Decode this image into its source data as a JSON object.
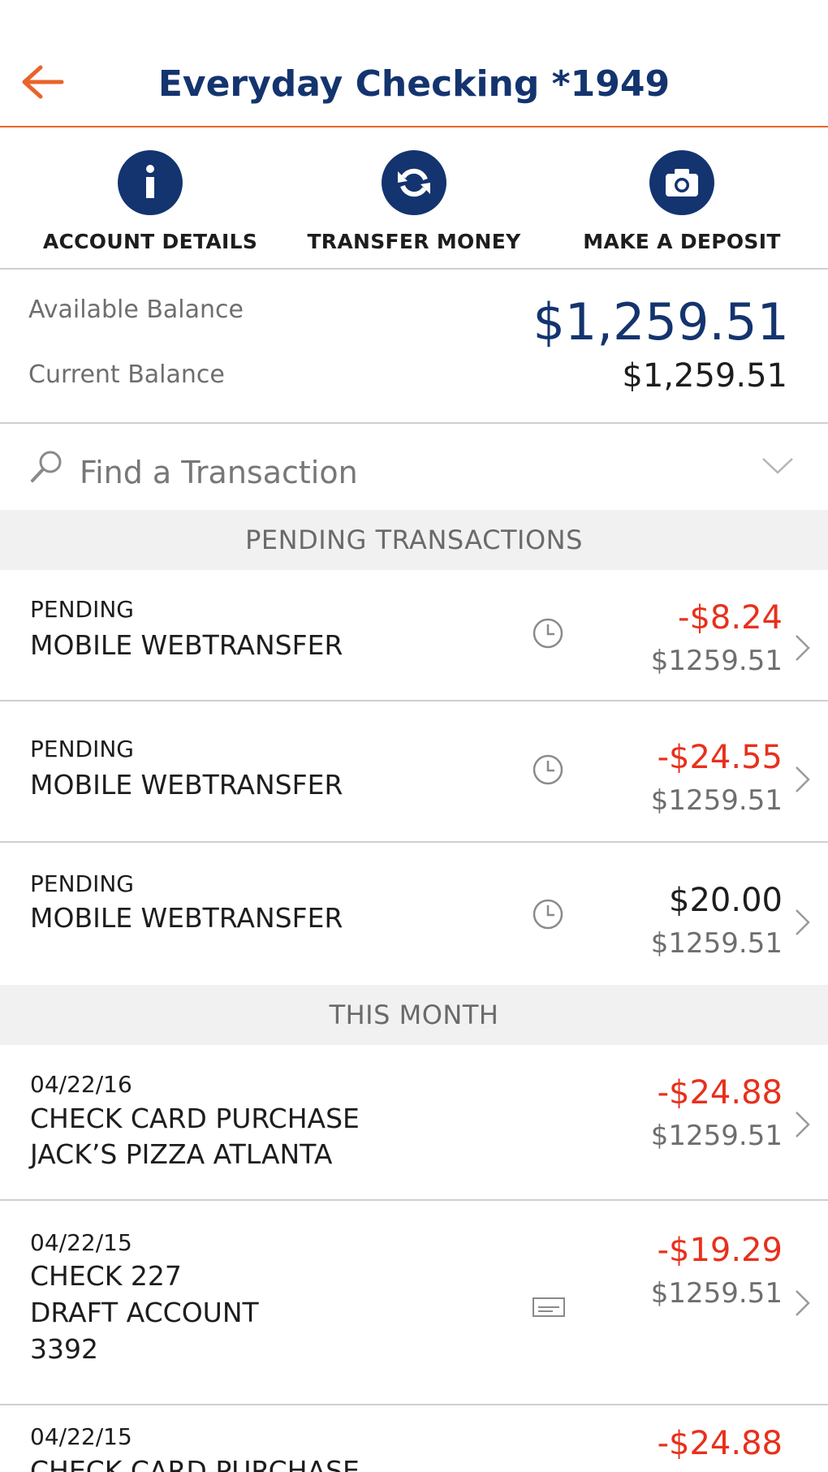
{
  "header": {
    "title": "Everyday Checking *1949"
  },
  "actions": [
    {
      "label": "ACCOUNT DETAILS",
      "icon": "info-icon"
    },
    {
      "label": "TRANSFER MONEY",
      "icon": "transfer-icon"
    },
    {
      "label": "MAKE A DEPOSIT",
      "icon": "camera-icon"
    }
  ],
  "balance": {
    "available_label": "Available Balance",
    "available_value": "$1,259.51",
    "current_label": "Current Balance",
    "current_value": "$1,259.51"
  },
  "search": {
    "placeholder": "Find a Transaction"
  },
  "sections": {
    "pending": "PENDING TRANSACTIONS",
    "this_month": "THIS MONTH"
  },
  "pending": [
    {
      "status": "PENDING",
      "description": "MOBILE WEBTRANSFER",
      "amount": "-$8.24",
      "running": "$1259.51",
      "negative": true
    },
    {
      "status": "PENDING",
      "description": "MOBILE WEBTRANSFER",
      "amount": "-$24.55",
      "running": "$1259.51",
      "negative": true
    },
    {
      "status": "PENDING",
      "description": "MOBILE WEBTRANSFER",
      "amount": "$20.00",
      "running": "$1259.51",
      "negative": false
    }
  ],
  "month": [
    {
      "date": "04/22/16",
      "lines": [
        "CHECK CARD PURCHASE",
        "JACK’S PIZZA ATLANTA"
      ],
      "amount": "-$24.88",
      "running": "$1259.51"
    },
    {
      "date": "04/22/15",
      "lines": [
        "CHECK 227",
        "DRAFT ACCOUNT",
        "3392"
      ],
      "amount": "-$19.29",
      "running": "$1259.51"
    },
    {
      "date": "04/22/15",
      "lines": [
        "CHECK CARD PURCHASE"
      ],
      "amount": "-$24.88",
      "running": ""
    }
  ],
  "colors": {
    "brand_navy": "#14346f",
    "accent_orange": "#e8642a",
    "negative_red": "#e8301c"
  }
}
